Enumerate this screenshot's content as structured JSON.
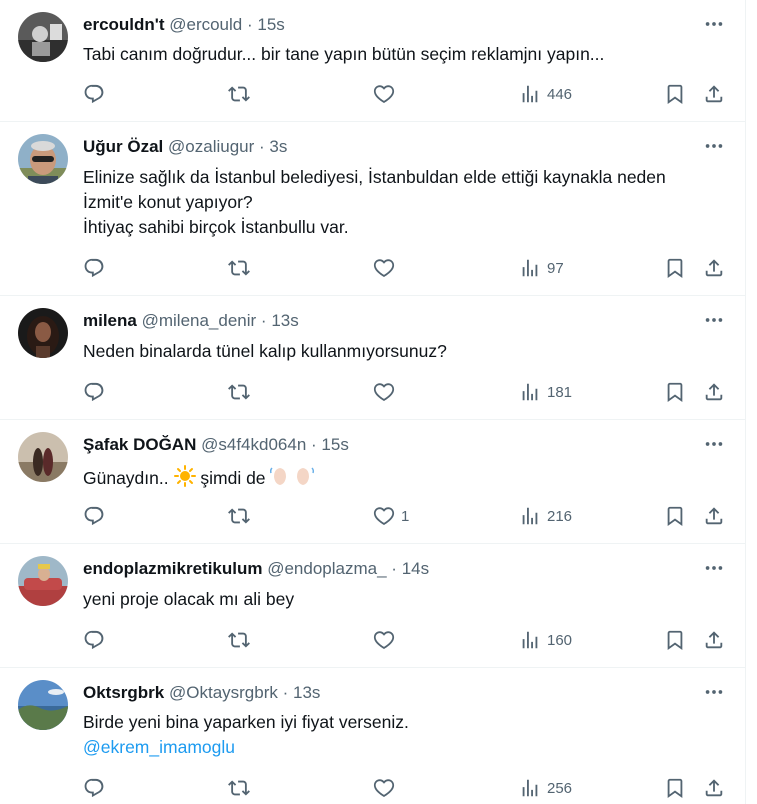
{
  "tweets": [
    {
      "name": "ercouldn't",
      "handle": "@ercould",
      "dot": "·",
      "time": "15s",
      "lines": [
        "Tabi canım doğrudur... bir tane yapın bütün seçim reklamjnı yapın..."
      ],
      "views": "446",
      "likes": "",
      "avatar_icon": "dark-photo-avatar"
    },
    {
      "name": "Uğur Özal",
      "handle": "@ozaliugur",
      "dot": "·",
      "time": "3s",
      "lines": [
        "Elinize sağlık da İstanbul belediyesi, İstanbuldan elde ettiği kaynakla neden",
        "İzmit'e konut yapıyor?",
        "İhtiyaç sahibi birçok İstanbullu var."
      ],
      "views": "97",
      "likes": "",
      "avatar_icon": "man-sunglasses-avatar"
    },
    {
      "name": "milena",
      "handle": "@milena_denir",
      "dot": "·",
      "time": "13s",
      "lines": [
        "Neden binalarda tünel kalıp kullanmıyorsunuz?"
      ],
      "views": "181",
      "likes": "",
      "avatar_icon": "woman-portrait-avatar"
    },
    {
      "name": "Şafak DOĞAN",
      "handle": "@s4f4kd064n",
      "dot": "·",
      "time": "15s",
      "line_prefix": "Günaydın..",
      "line_middle": "şimdi de",
      "views": "216",
      "likes": "1",
      "avatar_icon": "couple-landscape-avatar"
    },
    {
      "name": "endoplazmikretikulum",
      "handle": "@endoplazma_",
      "dot": "·",
      "time": "14s",
      "lines": [
        "yeni proje olacak mı ali bey"
      ],
      "views": "160",
      "likes": "",
      "avatar_icon": "red-car-avatar"
    },
    {
      "name": "Oktsrgbrk",
      "handle": "@Oktaysrgbrk",
      "dot": "·",
      "time": "13s",
      "lines": [
        "Birde yeni bina yaparken iyi fiyat verseniz."
      ],
      "mention": "@ekrem_imamoglu",
      "views": "256",
      "likes": "",
      "avatar_icon": "sea-landscape-avatar"
    }
  ],
  "colors": {
    "text": "#0f1419",
    "secondary": "#536471",
    "link": "#1d9bf0",
    "border": "#eff3f4"
  }
}
